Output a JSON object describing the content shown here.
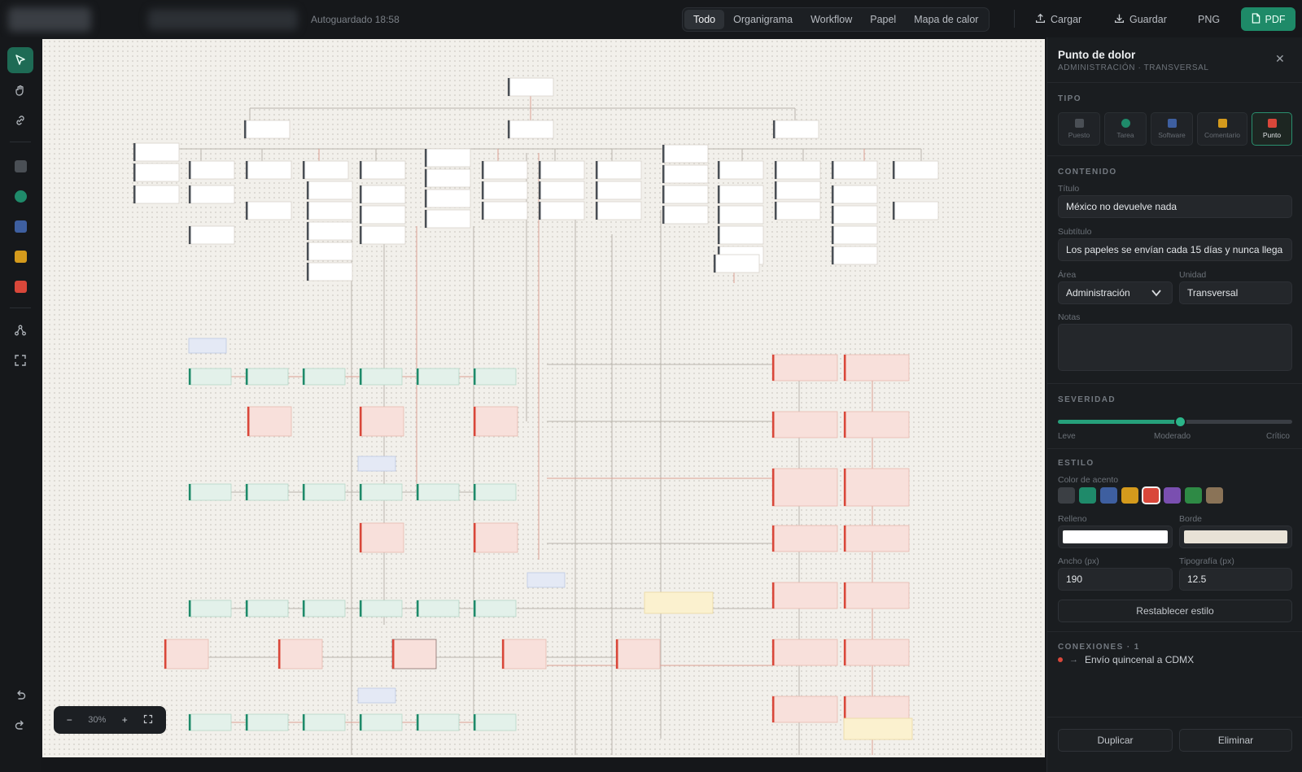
{
  "topbar": {
    "autosave": "Autoguardado 18:58",
    "tabs": [
      "Todo",
      "Organigrama",
      "Workflow",
      "Papel",
      "Mapa de calor"
    ],
    "active_tab": "Todo",
    "load_label": "Cargar",
    "save_label": "Guardar",
    "png_label": "PNG",
    "pdf_label": "PDF"
  },
  "tools": [
    "select-tool",
    "hand-tool",
    "link-tool",
    "puesto-swatch",
    "tarea-swatch",
    "software-swatch",
    "comentario-swatch",
    "punto-swatch",
    "hierarchy-tool",
    "fit-tool",
    "undo",
    "redo"
  ],
  "zoom": {
    "level": "30%",
    "minus": "−",
    "plus": "+"
  },
  "panel": {
    "title": "Punto de dolor",
    "subtitle": "ADMINISTRACIÓN · TRANSVERSAL",
    "close": "✕",
    "tipo_heading": "TIPO",
    "types": [
      {
        "label": "Puesto",
        "color": "#4a4f55"
      },
      {
        "label": "Tarea",
        "color": "#1f8a6a"
      },
      {
        "label": "Software",
        "color": "#3e5fa0"
      },
      {
        "label": "Comentario",
        "color": "#d49a1c"
      },
      {
        "label": "Punto",
        "color": "#d9473a"
      }
    ],
    "active_type": "Punto",
    "contenido_heading": "CONTENIDO",
    "titulo_label": "Título",
    "titulo_value": "México no devuelve nada",
    "subtitulo_label": "Subtítulo",
    "subtitulo_value": "Los papeles se envían cada 15 días y nunca llega",
    "area_label": "Área",
    "area_value": "Administración",
    "unidad_label": "Unidad",
    "unidad_value": "Transversal",
    "notas_label": "Notas",
    "notas_value": "",
    "severidad_heading": "SEVERIDAD",
    "severity": 0.52,
    "severity_labels": [
      "Leve",
      "Moderado",
      "Crítico"
    ],
    "estilo_heading": "ESTILO",
    "accent_label": "Color de acento",
    "accent_colors": [
      "#3b3f44",
      "#1f8a6a",
      "#3e5fa0",
      "#d49a1c",
      "#d9473a",
      "#7a4fb0",
      "#2e8a45",
      "#8a7357"
    ],
    "active_accent": "#d9473a",
    "relleno_label": "Relleno",
    "relleno_color": "#ffffff",
    "borde_label": "Borde",
    "borde_color": "#e8e2d6",
    "ancho_label": "Ancho (px)",
    "ancho_value": "190",
    "tipografia_label": "Tipografía (px)",
    "tipografia_value": "12.5",
    "reset_label": "Restablecer estilo",
    "conexiones_heading": "CONEXIONES · 1",
    "connection": "Envío quincenal a CDMX",
    "duplicate_label": "Duplicar",
    "delete_label": "Eliminar"
  }
}
